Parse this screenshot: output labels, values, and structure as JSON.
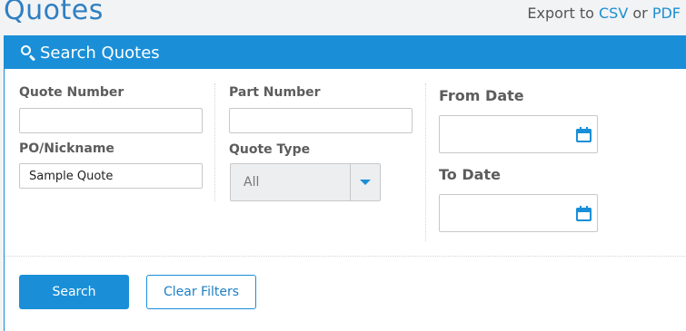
{
  "page": {
    "title": "Quotes"
  },
  "export": {
    "prefix": "Export to",
    "csv": "CSV",
    "or": "or",
    "pdf": "PDF"
  },
  "panel": {
    "title": "Search Quotes",
    "icon": "search-icon"
  },
  "fields": {
    "quote_number": {
      "label": "Quote Number",
      "value": ""
    },
    "po_nickname": {
      "label": "PO/Nickname",
      "value": "Sample Quote"
    },
    "part_number": {
      "label": "Part Number",
      "value": ""
    },
    "quote_type": {
      "label": "Quote Type",
      "value": "All"
    },
    "from_date": {
      "label": "From Date",
      "value": ""
    },
    "to_date": {
      "label": "To Date",
      "value": ""
    }
  },
  "buttons": {
    "search": "Search",
    "clear": "Clear Filters"
  },
  "colors": {
    "accent": "#1a8fd8",
    "title": "#2f7fc1"
  }
}
